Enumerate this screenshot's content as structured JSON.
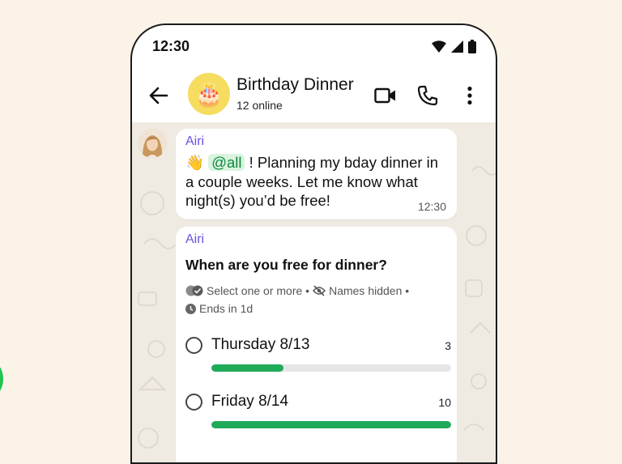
{
  "status_bar": {
    "time": "12:30"
  },
  "header": {
    "title": "Birthday Dinner",
    "subtitle": "12 online",
    "group_avatar_emoji": "🎂"
  },
  "messages": [
    {
      "sender": "Airi",
      "emoji": "👋",
      "mention": "@all",
      "text": " ! Planning my bday dinner in a couple weeks. Let me know what night(s) you’d be free!",
      "time": "12:30"
    }
  ],
  "poll": {
    "sender": "Airi",
    "question": "When are you free for dinner?",
    "meta_line1": "Select one or more •",
    "meta_line1b": "Names hidden •",
    "meta_line2": "Ends in 1d",
    "options": [
      {
        "label": "Thursday 8/13",
        "count": "3",
        "fill": 0.3
      },
      {
        "label": "Friday 8/14",
        "count": "10",
        "fill": 1.0
      }
    ]
  },
  "colors": {
    "accent_green": "#1faa59",
    "sender_purple": "#6c4fe0",
    "mention_bg": "#d9f3df",
    "chat_bg": "#efeae2"
  },
  "icons": [
    "back-arrow-icon",
    "video-call-icon",
    "phone-icon",
    "more-vert-icon",
    "wifi-icon",
    "signal-icon",
    "battery-icon",
    "double-check-icon",
    "eye-off-icon",
    "clock-icon"
  ]
}
